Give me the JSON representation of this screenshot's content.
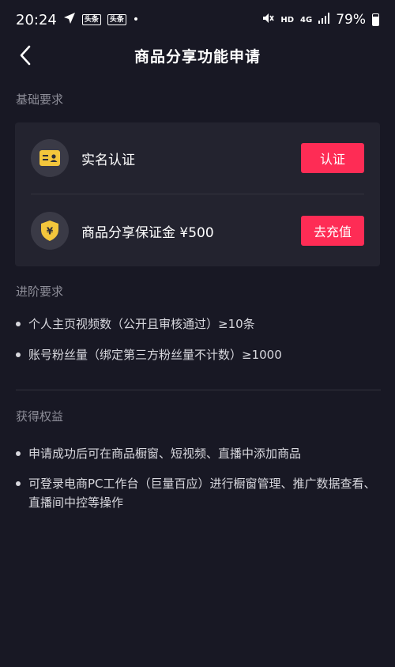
{
  "status_bar": {
    "time": "20:24",
    "badge_1": "头条",
    "badge_2": "头条",
    "dot": "•",
    "hd": "HD",
    "network": "4G",
    "battery": "79%"
  },
  "header": {
    "title": "商品分享功能申请"
  },
  "basic": {
    "label": "基础要求",
    "items": [
      {
        "label": "实名认证",
        "button": "认证",
        "icon": "id-card-icon"
      },
      {
        "label": "商品分享保证金 ¥500",
        "button": "去充值",
        "icon": "yuan-shield-icon"
      }
    ]
  },
  "advanced": {
    "label": "进阶要求",
    "items": [
      "个人主页视频数（公开且审核通过）≥10条",
      "账号粉丝量（绑定第三方粉丝量不计数）≥1000"
    ]
  },
  "benefits": {
    "label": "获得权益",
    "items": [
      "申请成功后可在商品橱窗、短视频、直播中添加商品",
      "可登录电商PC工作台（巨量百应）进行橱窗管理、推广数据查看、直播间中控等操作"
    ]
  },
  "colors": {
    "background": "#181824",
    "card": "#23232f",
    "accent": "#fe2c55",
    "icon_yellow": "#f3c63c"
  }
}
